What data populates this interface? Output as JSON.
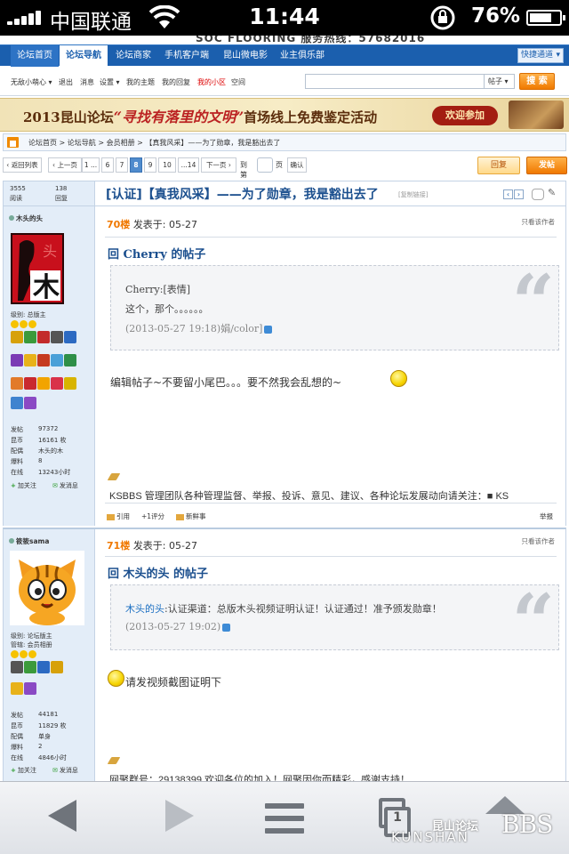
{
  "statusbar": {
    "carrier": "中国联通",
    "time": "11:44",
    "battery": "76%",
    "battery_level": 0.76
  },
  "banner_fragment": "SOC  FLOORING  服务热线：57682016",
  "nav": {
    "items": [
      "论坛首页",
      "论坛导航",
      "论坛商家",
      "手机客户端",
      "昆山微电影",
      "业主俱乐部"
    ],
    "quick": "快捷通道"
  },
  "userbar": {
    "user": "无敌小萌心",
    "items": [
      "退出",
      "消息",
      "设置",
      "我的主题",
      "我的回复",
      "我的小区",
      "空间"
    ],
    "search_type": "帖子",
    "search_button": "搜 索"
  },
  "ad": {
    "prefix": "2013昆山论坛",
    "highlight": "“寻找有落里的文明”",
    "suffix": "首场线上免费鉴定活动",
    "badge": "欢迎参加"
  },
  "breadcrumb": "论坛首页 > 论坛导航 > 会员相册 > 【真我风采】——为了勋章，我是豁出去了",
  "pager": {
    "prev_list": "返回列表",
    "prev": "上一页",
    "first": "1",
    "ellipsis": "...",
    "pages": [
      "6",
      "7",
      "8",
      "9",
      "10"
    ],
    "current": "8",
    "last": "...14",
    "next": "下一页",
    "goto_prefix": "到第",
    "goto_suffix": "页",
    "confirm": "确认",
    "reply": "回复",
    "post": "发帖"
  },
  "thread": {
    "views": "3555",
    "views_label": "阅读",
    "replies": "138",
    "replies_label": "回复",
    "title": "[认证]【真我风采】——为了勋章，我是豁出去了",
    "copy_link": "[复制链接]"
  },
  "posts": [
    {
      "author": "木头的头",
      "rank": "级别: 总版主",
      "stats": [
        {
          "k": "发帖",
          "v": "97372"
        },
        {
          "k": "昆币",
          "v": "16161 枚"
        },
        {
          "k": "配偶",
          "v": "木头的木"
        },
        {
          "k": "爆料",
          "v": "8"
        },
        {
          "k": "在线",
          "v": "13243小时"
        }
      ],
      "follow": "加关注",
      "message": "发消息",
      "floor": "70楼",
      "posted": "发表于: 05-27",
      "only_author": "只看该作者",
      "reply_title": "回 Cherry 的帖子",
      "quote_lines": [
        "Cherry:[表情]",
        "这个，那个。。。。。。",
        "(2013-05-27 19:18)娟/color]"
      ],
      "body": "编辑帖子~不要留小尾巴。。。要不然我会乱想的~",
      "signature": "KSBBS 管理团队各种管理监督、举报、投诉、意见、建议、各种论坛发展动向请关注：■ KS",
      "actions": [
        "引用",
        "+1评分",
        "新鲜事"
      ],
      "report": "举报"
    },
    {
      "author": "筱筱sama",
      "rank": "级别: 论坛版主",
      "role": "管辖: 会员相册",
      "stats": [
        {
          "k": "发帖",
          "v": "44181"
        },
        {
          "k": "昆币",
          "v": "11829 枚"
        },
        {
          "k": "配偶",
          "v": "单身"
        },
        {
          "k": "爆料",
          "v": "2"
        },
        {
          "k": "在线",
          "v": "4846小时"
        }
      ],
      "follow": "加关注",
      "message": "发消息",
      "floor": "71楼",
      "posted": "发表于: 05-27",
      "only_author": "只看该作者",
      "reply_title": "回 木头的头 的帖子",
      "quote_author": "木头的头",
      "quote_lines": [
        ":认证渠道：总版木头视频证明认证！认证通过！准予颁发勋章！",
        "(2013-05-27 19:02)"
      ],
      "body": "请发视频截图证明下",
      "signature": "网聚群号：29138399 欢迎各位的加入！网聚因你而精彩，感谢支持！"
    }
  ],
  "toolbar": {
    "tabs_count": "1"
  },
  "watermark": {
    "cn": "昆山论坛",
    "bbs": "BBS",
    "en": "KUNSHAN"
  }
}
